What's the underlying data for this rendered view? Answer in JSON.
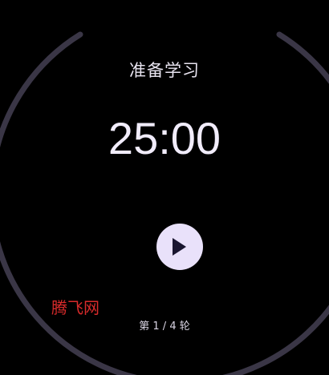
{
  "session": {
    "status_label": "准备学习",
    "time_remaining": "25:00",
    "round_label": "第 1 / 4 轮",
    "progress": 0
  },
  "controls": {
    "primary_icon": "play-icon"
  },
  "watermark": {
    "text": "腾飞网"
  },
  "colors": {
    "background": "#000000",
    "ring_track": "#3A3646",
    "button_fill": "#E9E1FA",
    "icon": "#1A1630",
    "text_primary": "#F1ECFB",
    "watermark": "#D92B2B"
  }
}
